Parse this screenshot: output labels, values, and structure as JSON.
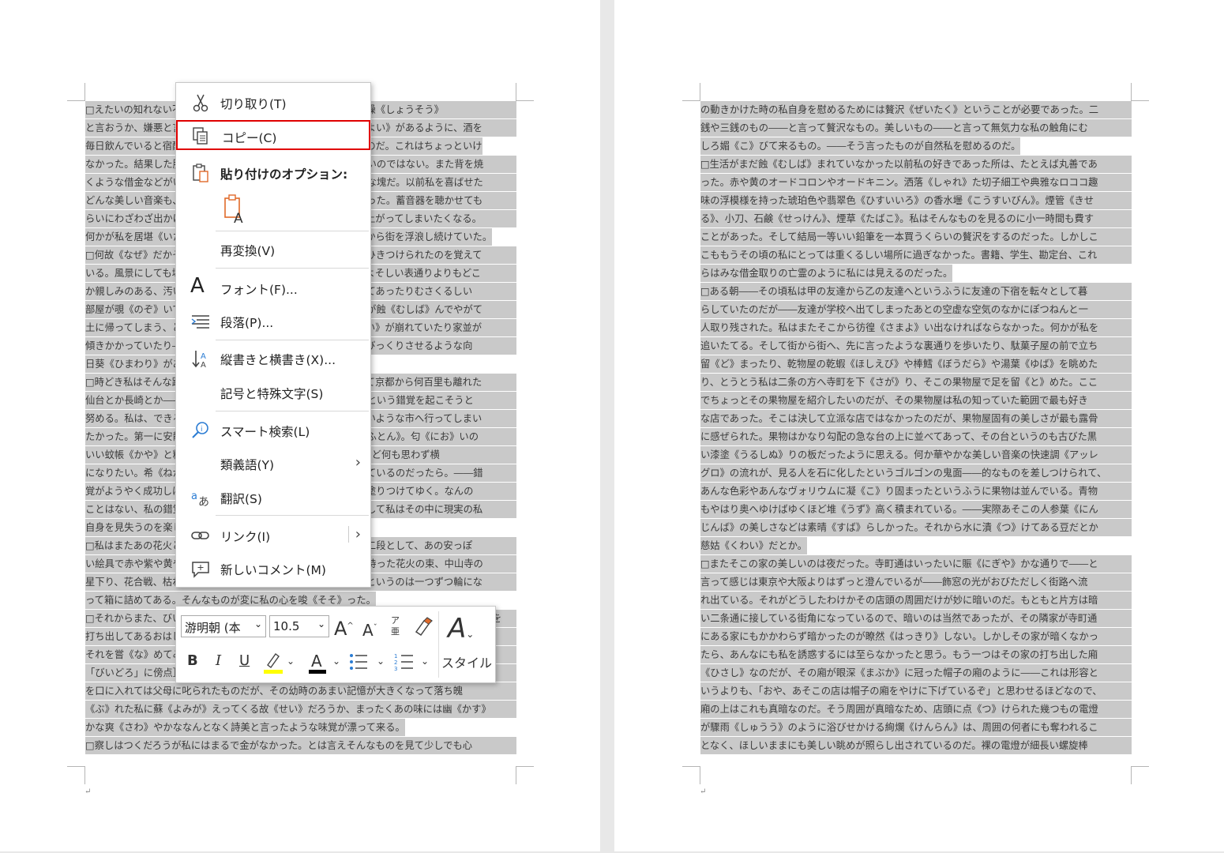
{
  "document": {
    "left_page_lines": [
      "□えたいの知れない不吉な塊が私の心を始終圧えつけていた。焦躁《しょうそう》",
      "と言おうか、嫌悪と言おうか――酒を飲んだあとに宿酔《ふつかよい》があるように、酒を",
      "毎日飲んでいると宿酔に相当した時期がやって来る。それが来たのだ。これはちょっといけ",
      "なかった。結果した肺尖《はいせん》カタルや神経衰弱がいけないのではない。また背を焼",
      "くような借金などがいけないのではない。いけないのはその不吉な塊だ。以前私を喜ばせた",
      "どんな美しい音楽も、どんな美しい詩の一節も辛抱がならなくなった。蓄音器を聴かせても",
      "らいにわざわざ出かけて行っても、最初の二三小節で不意に立ち上がってしまいたくなる。",
      "何かが私を居堪《いたたま》らずさせるのだ。それで始終私は街から街を浮浪し続けていた。",
      "□何故《なぜ》だかその頃私は見すぼらしくて美しいものに強くひきつけられたのを覚えて",
      "いる。風景にしても壊れかかった街だとか、その街にしてもよそよそしい表通りよりもどこ",
      "か親しみのある、汚い洗濯物が干してあったりがらくたが転がしてあったりむさくるしい",
      "部屋が覗《のぞ》いていたりする裏通りが好きであった。雨や風が蝕《むしば》んでやがて",
      "土に帰ってしまう、と言ったような趣きのある街で、土塀《どべい》が崩れていたり家並が",
      "傾きかかっていたり――勢いのいいのは植物だけで、時とするとびっくりさせるような向",
      "日葵《ひまわり》があったりカンナが咲いていたりする。",
      "□時どき私はそんな路を歩きながら、ふと、そこが京都ではなくて京都から何百里も離れた",
      "仙台とか長崎とか――そのような市へ今自分が来ているのだ――という錯覚を起こそうと",
      "努める。私は、できることなら京都から逃げ出して誰一人知らないような市へ行ってしまい",
      "たかった。第一に安静。がらんとした旅館の一室。清浄な蒲団《ふとん》。匂《にお》いの",
      "いい蚊帳《かや》と糊のよくきいた浴衣《ゆかた》。そこで一月ほど何も思わず横",
      "になりたい。希《ねが》わくはここがいつの間にかその市になっているのだったら。――錯",
      "覚がようやく成功しはじめると私はそれからそれへ想像の絵具を塗りつけてゆく。なんの",
      "ことはない、私の錯覚と壊れかかった街との二重写しである。そして私はその中に現実の私",
      "自身を見失うのを楽しんだ。",
      "□私はまたあの花火という奴が好きになった。花火そのものは第二段として、あの安っぽ",
      "い絵具で赤や紫や黄や青や、さまざまの縞模様《しまもよう》を持った花火の束、中山寺の",
      "星下り、花合戦、枯れすすき。それから鼠花火《ねずみはなび》というのは一つずつ輪にな",
      "って箱に詰めてある。そんなものが変に私の心を唆《そそ》った。",
      "□それからまた、びいどろという色硝子で鯛や花を打ち出してあるおはじきが好きになった花を",
      "打ち出してあるおはじきが好きになったし、南京玉が好きになった。またまた",
      "それを嘗《な》めてみるのが私にとって何ともいえない享楽だったのだ。あの［＃",
      "「びいどろ」に傍点］の味ほど幽《かす》かな涼しい味があるものか。私は幼い時よくそれ",
      "を口に入れては父母に叱られたものだが、その幼時のあまい記憶が大きくなって落ち魄",
      "《ぶ》れた私に蘇《よみが》えってくる故《せい》だろうか、まったくあの味には幽《かす》",
      "かな爽《さわ》やかななんとなく詩美と言ったような味覚が漂って来る。",
      "□察しはつくだろうが私にはまるで金がなかった。とは言えそんなものを見て少しでも心"
    ],
    "right_page_lines": [
      "の動きかけた時の私自身を慰めるためには贅沢《ぜいたく》ということが必要であった。二",
      "銭や三銭のもの――と言って贅沢なもの。美しいもの――と言って無気力な私の触角にむ",
      "しろ媚《こ》びて来るもの。――そう言ったものが自然私を慰めるのだ。",
      "□生活がまだ蝕《むしば》まれていなかった以前私の好きであった所は、たとえば丸善であ",
      "った。赤や黄のオードコロンやオードキニン。洒落《しゃれ》た切子細工や典雅なロココ趣",
      "味の浮模様を持った琥珀色や翡翠色《ひすいいろ》の香水壜《こうすいびん》。煙管《きせ",
      "る》、小刀、石鹸《せっけん》、煙草《たばこ》。私はそんなものを見るのに小一時間も費す",
      "ことがあった。そして結局一等いい鉛筆を一本買うくらいの贅沢をするのだった。しかしこ",
      "こももうその頃の私にとっては重くるしい場所に過ぎなかった。書籍、学生、勘定台、これ",
      "らはみな借金取りの亡霊のように私には見えるのだった。",
      "□ある朝――その頃私は甲の友達から乙の友達へというふうに友達の下宿を転々として暮",
      "らしていたのだが――友達が学校へ出てしまったあとの空虚な空気のなかにぽつねんと一",
      "人取り残された。私はまたそこから彷徨《さまよ》い出なければならなかった。何かが私を",
      "追いたてる。そして街から街へ、先に言ったような裏通りを歩いたり、駄菓子屋の前で立ち",
      "留《ど》まったり、乾物屋の乾蝦《ほしえび》や棒鱈《ぼうだら》や湯葉《ゆば》を眺めた",
      "り、とうとう私は二条の方へ寺町を下《さが》り、そこの果物屋で足を留《と》めた。ここ",
      "でちょっとその果物屋を紹介したいのだが、その果物屋は私の知っていた範囲で最も好き",
      "な店であった。そこは決して立派な店ではなかったのだが、果物屋固有の美しさが最も露骨",
      "に感ぜられた。果物はかなり勾配の急な台の上に並べてあって、その台というのも古びた黒",
      "い漆塗《うるしぬ》りの板だったように思える。何か華やかな美しい音楽の快速調《アッレ",
      "グロ》の流れが、見る人を石に化したというゴルゴンの鬼面――的なものを差しつけられて、",
      "あんな色彩やあんなヴォリウムに凝《こ》り固まったというふうに果物は並んでいる。青物",
      "もやはり奥へゆけばゆくほど堆《うず》高く積まれている。――実際あそこの人参葉《にん",
      "じんば》の美しさなどは素晴《すば》らしかった。それから水に漬《つ》けてある豆だとか",
      "慈姑《くわい》だとか。",
      "□またそこの家の美しいのは夜だった。寺町通はいったいに賑《にぎや》かな通りで――と",
      "言って感じは東京や大阪よりはずっと澄んでいるが――飾窓の光がおびただしく街路へ流",
      "れ出ている。それがどうしたわけかその店頭の周囲だけが妙に暗いのだ。もともと片方は暗",
      "い二条通に接している街角になっているので、暗いのは当然であったが、その隣家が寺町通",
      "にある家にもかかわらず暗かったのが瞭然《はっきり》しない。しかしその家が暗くなかっ",
      "たら、あんなにも私を誘惑するには至らなかったと思う。もう一つはその家の打ち出した廂",
      "《ひさし》なのだが、その廂が眼深《まぶか》に冠った帽子の廂のように――これは形容と",
      "いうよりも、「おや、あそこの店は帽子の廂をやけに下げているぞ」と思わせるほどなので、",
      "廂の上はこれも真暗なのだ。そう周囲が真暗なため、店頭に点《つ》けられた幾つもの電燈",
      "が驟雨《しゅうう》のように浴びせかける絢爛《けんらん》は、周囲の何者にも奪われるこ",
      "となく、ほしいままにも美しい眺めが照らし出されているのだ。裸の電燈が細長い螺旋棒"
    ],
    "left_short_lines": [
      2,
      7,
      14,
      23,
      27,
      34
    ],
    "right_short_lines": [
      2,
      9,
      24
    ],
    "end_marks": [
      "↵",
      "↵"
    ]
  },
  "context_menu": {
    "cut": "切り取り(T)",
    "copy": "コピー(C)",
    "paste_options": "貼り付けのオプション:",
    "reconvert": "再変換(V)",
    "font": "フォント(F)...",
    "paragraph": "段落(P)...",
    "text_direction": "縦書きと横書き(X)...",
    "symbols": "記号と特殊文字(S)",
    "smart_lookup": "スマート検索(L)",
    "synonyms": "類義語(Y)",
    "translate": "翻訳(S)",
    "link": "リンク(I)",
    "new_comment": "新しいコメント(M)"
  },
  "mini_toolbar": {
    "font_name": "游明朝 (本",
    "font_size": "10.5",
    "bold": "B",
    "italic": "I",
    "underline": "U",
    "phonetic_top": "ア",
    "phonetic_bottom": "亜",
    "styles": "スタイル",
    "highlight_color": "#ffff00",
    "font_color": "#000000"
  },
  "colors": {
    "selection": "#c9c9c9",
    "copy_highlight_border": "#e00000"
  }
}
